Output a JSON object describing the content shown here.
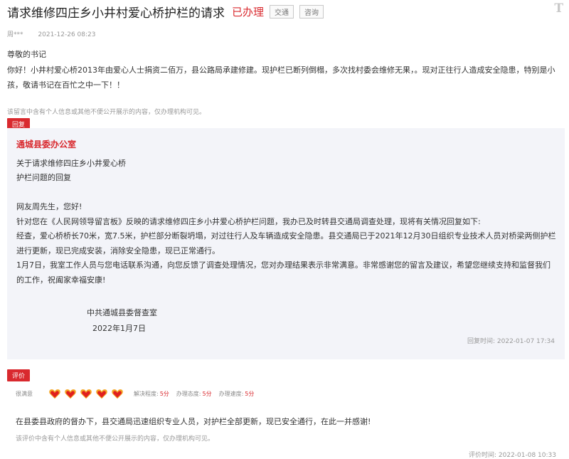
{
  "header": {
    "title": "请求维修四庄乡小井村爱心桥护栏的请求",
    "status": "已办理",
    "tags": [
      "交通",
      "咨询"
    ],
    "text_size_icon": "T"
  },
  "meta": {
    "author": "周***",
    "date": "2021-12-26 08:23"
  },
  "message": {
    "greeting": "尊敬的书记",
    "body": "你好！小井村爱心桥2013年由爱心人士捐资二佰万，县公路局承建修建。现护栏已断列倒榻，多次找村委会维修无果，。现对正往行人造成安全隐患，特别是小孩，敬请书记在百忙之中一下！！",
    "privacy_note": "该留言中含有个人信息或其他不便公开展示的内容，仅办理机构可见。"
  },
  "reply": {
    "badge": "回复",
    "org": "通城县委办公室",
    "subject_line1": "关于请求维修四庄乡小井爱心桥",
    "subject_line2": "护栏问题的回复",
    "salutation": "网友周先生，您好!",
    "para1": "针对您在《人民网领导留言板》反映的请求维修四庄乡小井爱心桥护栏问题，我办已及时转县交通局调查处理，现将有关情况回复如下:",
    "para2": "经查，爱心桥桥长70米，宽7.5米，护栏部分断裂坍塌，对过往行人及车辆造成安全隐患。县交通局已于2021年12月30日组织专业技术人员对桥梁两侧护栏进行更新，现已完成安装，消除安全隐患，现已正常通行。",
    "para3": "1月7日，我室工作人员与您电话联系沟通，向您反馈了调查处理情况，您对办理结果表示非常满意。非常感谢您的留言及建议，希望您继续支持和监督我们的工作，祝阖家幸福安康!",
    "signature": "中共通城县委督查室",
    "sign_date": "2022年1月7日",
    "time_label": "回复时间:",
    "time": "2022-01-07 17:34"
  },
  "evaluation": {
    "badge": "评价",
    "satisfaction_label": "很满意",
    "hearts": 5,
    "heart_color": "#f5a623",
    "heart_color_dark": "#e02020",
    "scores": [
      {
        "label": "解决程度:",
        "value": "5分"
      },
      {
        "label": "办理态度:",
        "value": "5分"
      },
      {
        "label": "办理速度:",
        "value": "5分"
      }
    ],
    "text": "在县委县政府的督办下，县交通局迅速组织专业人员，对护栏全部更新，现已安全通行，在此一并感谢!",
    "privacy_note": "该评价中含有个人信息或其他不便公开展示的内容，仅办理机构可见。",
    "time_label": "评价时间:",
    "time": "2022-01-08 10:33"
  },
  "colors": {
    "accent": "#d9292e",
    "reply_bg": "#f3f4f9"
  }
}
